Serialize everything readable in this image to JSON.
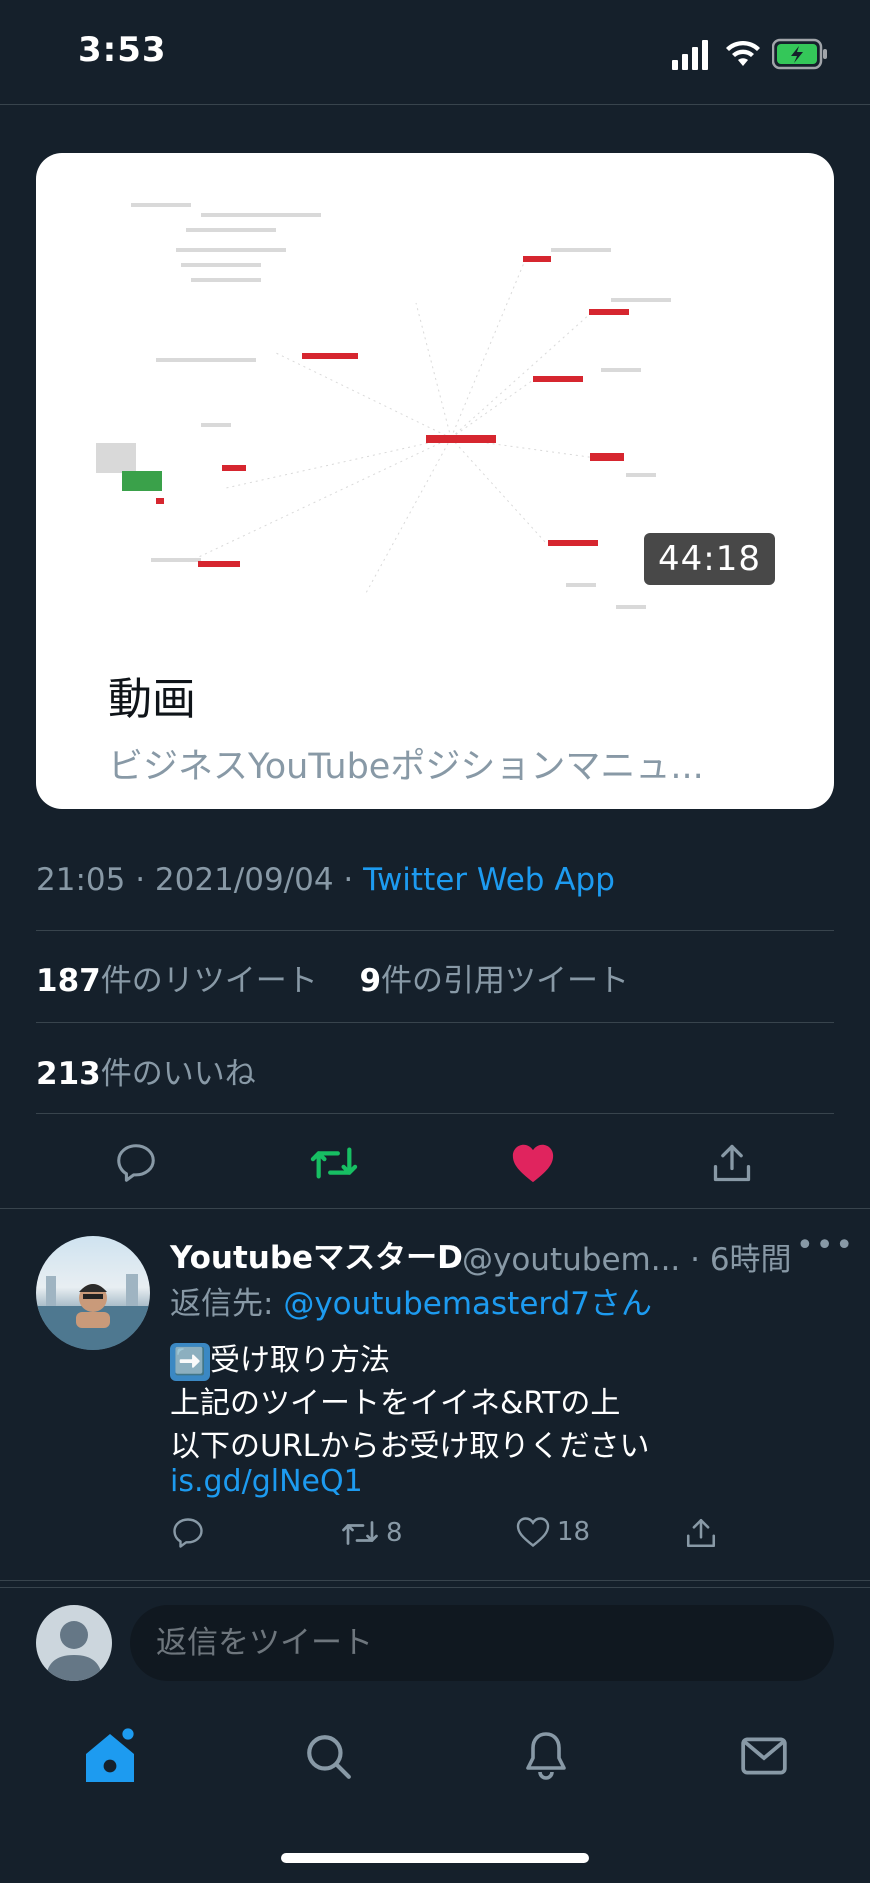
{
  "status_bar": {
    "time": "3:53"
  },
  "card": {
    "duration": "44:18",
    "title": "動画",
    "description": "ビジネスYouTubeポジションマニュ..."
  },
  "meta": {
    "datetime": "21:05 · 2021/09/04 · ",
    "source": "Twitter Web App"
  },
  "stats": {
    "retweets_count": "187",
    "retweets_label": "件のリツイート",
    "quotes_count": "9",
    "quotes_label": "件の引用ツイート",
    "likes_count": "213",
    "likes_label": "件のいいね"
  },
  "colors": {
    "accent": "#1d9bf0",
    "retweet": "#17bf63",
    "like": "#e0245e",
    "background": "#15202b"
  },
  "reply": {
    "name": "YoutubeマスターD",
    "handle_time": "@youtubem... · 6時間",
    "more": "•••",
    "reply_to_prefix": "返信先: ",
    "reply_to_mention": "@youtubemasterd7さん",
    "line1_emoji": "➡️",
    "line1": "受け取り方法",
    "line2": "上記のツイートをイイネ&RTの上",
    "line3": "以下のURLからお受け取りください",
    "link": "is.gd/glNeQ1",
    "retweets": "8",
    "likes": "18"
  },
  "compose": {
    "placeholder": "返信をツイート"
  },
  "tabs": [
    "home-icon",
    "search-icon",
    "bell-icon",
    "mail-icon"
  ]
}
